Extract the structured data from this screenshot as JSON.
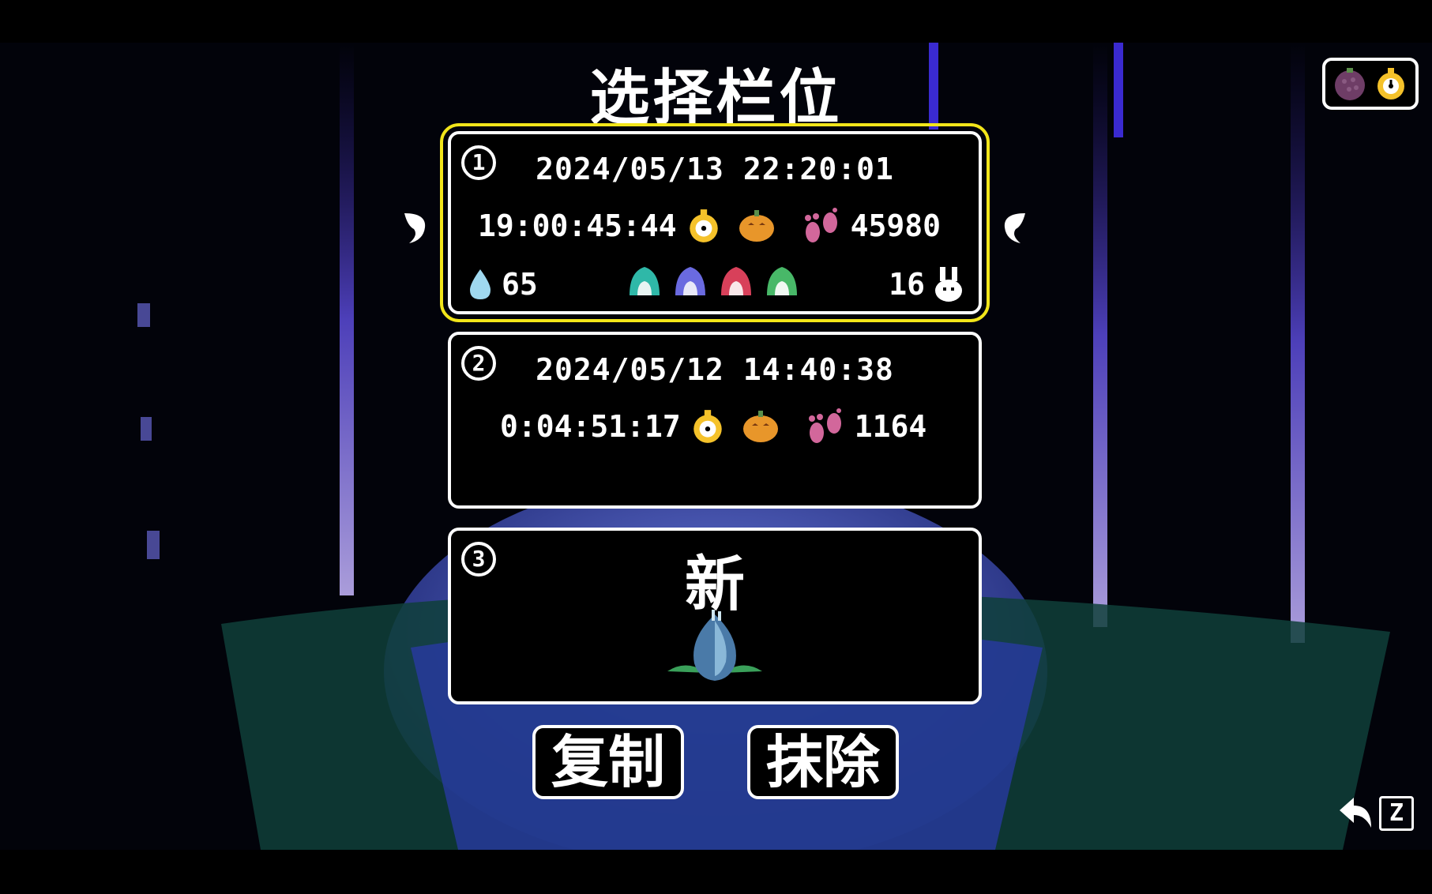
{
  "screen": {
    "title": "选择栏位"
  },
  "slots": [
    {
      "number": "1",
      "timestamp": "2024/05/13  22:20:01",
      "playtime": "19:00:45:44",
      "steps": "45980",
      "drops": "65",
      "rabbits": "16",
      "selected": true
    },
    {
      "number": "2",
      "timestamp": "2024/05/12  14:40:38",
      "playtime": "0:04:51:17",
      "steps": "1164",
      "selected": false
    },
    {
      "number": "3",
      "new_label": "新",
      "selected": false
    }
  ],
  "buttons": {
    "copy": "复制",
    "erase": "抹除"
  },
  "back_hint": {
    "key": "Z"
  },
  "colors": {
    "selection": "#f2e51a",
    "stopwatch": "#f5c22a",
    "pumpkin": "#e8962a",
    "paw": "#d2679b",
    "drop": "#9fd8ef"
  }
}
